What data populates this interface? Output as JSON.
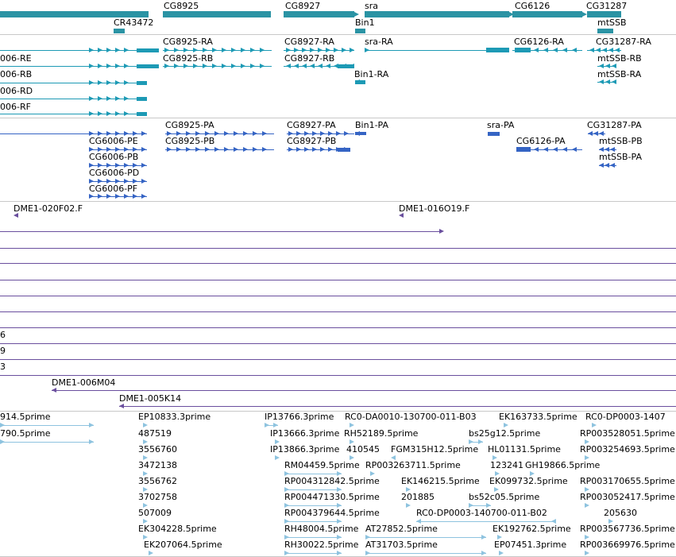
{
  "colors": {
    "gene": "#2a93a4",
    "gene_dark": "#1f7f8f",
    "transcript": "#1d9ab5",
    "protein": "#3564c4",
    "clone": "#6a4f9e",
    "est": "#8ec3df",
    "separator": "#c8c8c8"
  },
  "genes": {
    "labels": [
      "CG8925",
      "CG8927",
      "sra",
      "CG6126",
      "CG31287",
      "CR43472",
      "Bin1",
      "mtSSB"
    ]
  },
  "transcripts": {
    "labels": [
      "006-RE",
      "006-RB",
      "006-RD",
      "006-RF",
      "CG8925-RA",
      "CG8925-RB",
      "CG8927-RA",
      "CG8927-RB",
      "sra-RA",
      "Bin1-RA",
      "CG6126-RA",
      "CG31287-RA",
      "mtSSB-RB",
      "mtSSB-RA"
    ]
  },
  "proteins": {
    "labels": [
      "CG8925-PA",
      "CG8925-PB",
      "CG8927-PA",
      "CG8927-PB",
      "Bin1-PA",
      "sra-PA",
      "CG31287-PA",
      "mtSSB-PB",
      "mtSSB-PA",
      "CG6126-PA",
      "CG6006-PE",
      "CG6006-PB",
      "CG6006-PD",
      "CG6006-PF"
    ]
  },
  "clones": {
    "labels": [
      "DME1-020F02.F",
      "DME1-016O19.F",
      "6",
      "9",
      "3",
      "DME1-006M04",
      "DME1-005K14"
    ]
  },
  "ests": {
    "labels": [
      "914.5prime",
      "790.5prime",
      "EP10833.3prime",
      "487519",
      "3556760",
      "3472138",
      "3556762",
      "3702758",
      "507009",
      "EK304228.5prime",
      "EK207064.5prime",
      "IP13766.3prime",
      "IP13666.3prime",
      "IP13866.3prime",
      "RH52189.5prime",
      "410545",
      "RC0-DA0010-130700-011-B03",
      "EK163733.5prime",
      "RC0-DP0003-1407",
      "bs25g12.5prime",
      "RP003528051.5prime",
      "RP003254693.5prime",
      "FGM315H12.5prime",
      "HL01131.5prime",
      "RM04459.5prime",
      "RP003263711.5prime",
      "123241",
      "GH19866.5prime",
      "RP004312842.5prime",
      "EK146215.5prime",
      "EK099732.5prime",
      "RP003170655.5prime",
      "RP004471330.5prime",
      "201885",
      "bs52c05.5prime",
      "RP003052417.5prime",
      "RP004379644.5prime",
      "RC0-DP0003-140700-011-B02",
      "205630",
      "RH48004.5prime",
      "AT27852.5prime",
      "EK192762.5prime",
      "RP003567736.5prime",
      "RH30022.5prime",
      "AT31703.5prime",
      "EP07451.3prime",
      "RP003669976.5prime"
    ]
  }
}
